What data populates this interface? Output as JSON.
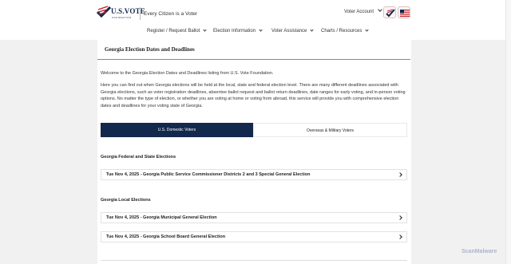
{
  "header": {
    "logo_text": "U.S.VOTE",
    "logo_sub": "FOUNDATION",
    "tagline": "Every Citizen is a Voter",
    "voter_account": "Voter Account"
  },
  "nav": [
    {
      "label": "Register / Request Ballot"
    },
    {
      "label": "Election Information"
    },
    {
      "label": "Voter Assistance"
    },
    {
      "label": "Charts / Resources"
    }
  ],
  "page": {
    "title": "Georgia Election Dates and Deadlines",
    "intro": "Welcome to the Georgia Election Dates and Deadlines listing from U.S. Vote Foundation.",
    "description": "Here you can find out when Georgia elections will be held at the local, state and federal election level. There are many different deadlines associated with Georgia elections, such as voter registration deadlines, absentee ballot request and ballot return deadlines, date ranges for early voting, and in-person voting options. No matter the type of election, or whether you are voting at home or voting from abroad, this service will provide you with comprehensive election dates and deadlines for your voting state of Georgia."
  },
  "tabs": [
    {
      "label": "U.S. Domestic Voters",
      "active": true
    },
    {
      "label": "Overseas & Military Voters",
      "active": false
    }
  ],
  "sections": [
    {
      "heading": "Georgia Federal and State Elections",
      "rows": [
        {
          "label": "Tue Nov 4, 2025 - Georgia Public Service Commissioner Districts 2 and 3 Special General Election"
        }
      ]
    },
    {
      "heading": "Georgia Local Elections",
      "rows": [
        {
          "label": "Tue Nov 4, 2025 - Georgia Municipal General Election"
        },
        {
          "label": "Tue Nov 4, 2025 - Georgia School Board General Election"
        }
      ]
    }
  ],
  "watermark": "ScanMalware",
  "colors": {
    "navy": "#12284c",
    "flag_red": "#c0242f"
  }
}
